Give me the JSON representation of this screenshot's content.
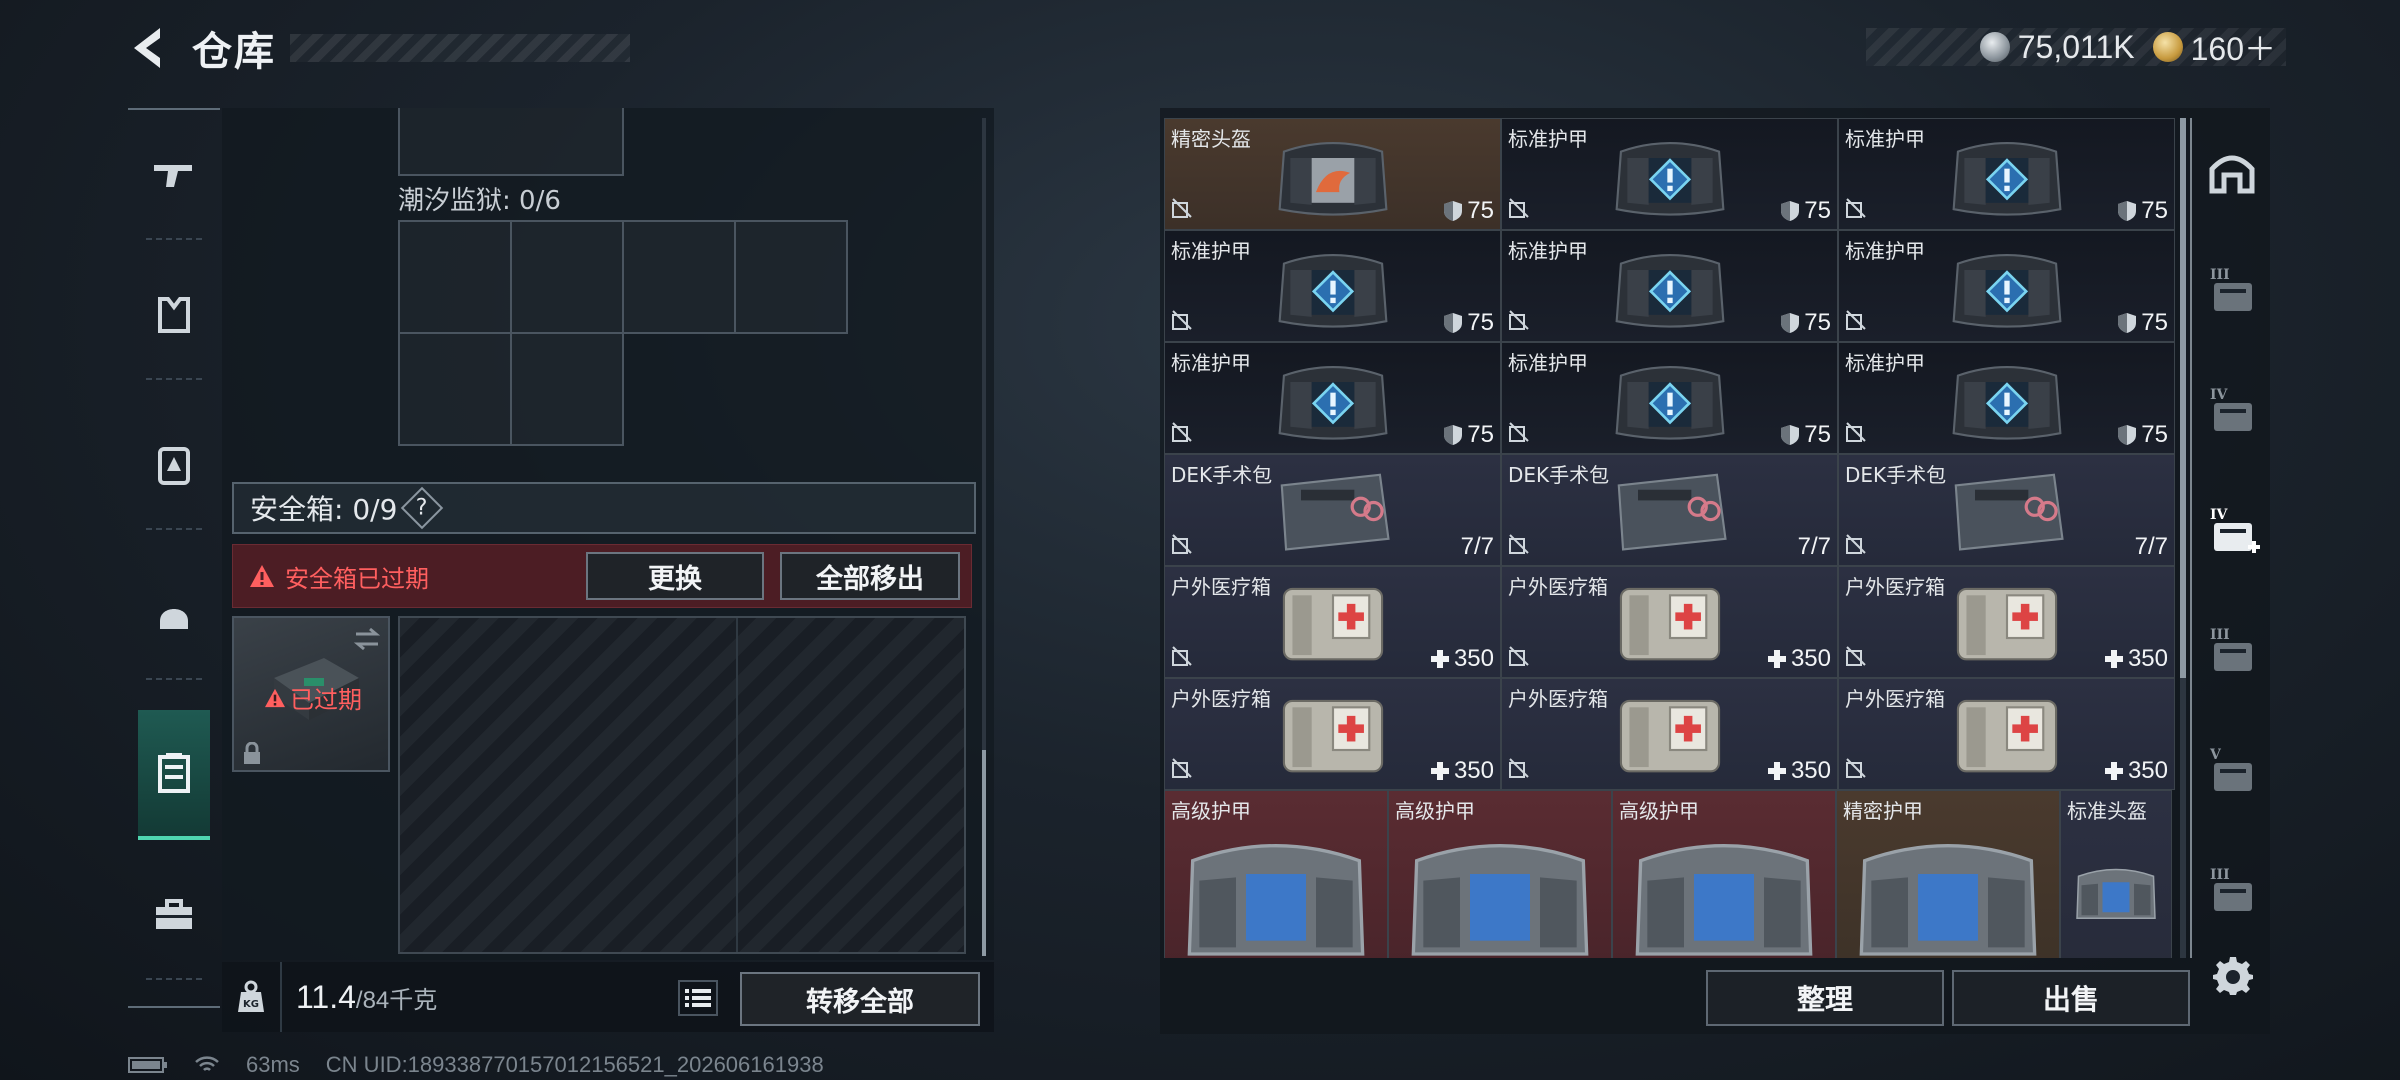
{
  "header": {
    "title": "仓库",
    "currency_silver": "75,011K",
    "currency_gold": "160＋"
  },
  "left_nav": [
    "gun",
    "vest",
    "backpack-armor",
    "helmet",
    "safebox",
    "toolbox"
  ],
  "left_panel": {
    "tide_prison_label": "潮汐监狱: 0/6",
    "safebox_label": "安全箱: 0/9",
    "safebox_help": "?",
    "expired_warning": "安全箱已过期",
    "replace_label": "更换",
    "remove_all_label": "全部移出",
    "thumb_expired": "已过期",
    "weight_value": "11.4",
    "weight_capacity": "/84千克",
    "transfer_all_label": "转移全部"
  },
  "status": {
    "ping": "63ms",
    "uid": "CN UID:1893387701570121565​21_202606161938"
  },
  "items": [
    {
      "name": "精密头盔",
      "stat": "75",
      "kind": "helmet-p"
    },
    {
      "name": "标准护甲",
      "stat": "75",
      "kind": "armor"
    },
    {
      "name": "标准护甲",
      "stat": "75",
      "kind": "armor"
    },
    {
      "name": "标准护甲",
      "stat": "75",
      "kind": "armor"
    },
    {
      "name": "标准护甲",
      "stat": "75",
      "kind": "armor"
    },
    {
      "name": "标准护甲",
      "stat": "75",
      "kind": "armor"
    },
    {
      "name": "标准护甲",
      "stat": "75",
      "kind": "armor"
    },
    {
      "name": "标准护甲",
      "stat": "75",
      "kind": "armor"
    },
    {
      "name": "标准护甲",
      "stat": "75",
      "kind": "armor"
    },
    {
      "name": "DEK手术包",
      "stat": "7/7",
      "kind": "surgery"
    },
    {
      "name": "DEK手术包",
      "stat": "7/7",
      "kind": "surgery"
    },
    {
      "name": "DEK手术包",
      "stat": "7/7",
      "kind": "surgery"
    },
    {
      "name": "户外医疗箱",
      "stat": "350",
      "kind": "medkit"
    },
    {
      "name": "户外医疗箱",
      "stat": "350",
      "kind": "medkit"
    },
    {
      "name": "户外医疗箱",
      "stat": "350",
      "kind": "medkit"
    },
    {
      "name": "户外医疗箱",
      "stat": "350",
      "kind": "medkit"
    },
    {
      "name": "户外医疗箱",
      "stat": "350",
      "kind": "medkit"
    },
    {
      "name": "户外医疗箱",
      "stat": "350",
      "kind": "medkit"
    }
  ],
  "bottom_row": [
    {
      "name": "高级护甲",
      "kind": "adv"
    },
    {
      "name": "高级护甲",
      "kind": "adv"
    },
    {
      "name": "高级护甲",
      "kind": "adv"
    },
    {
      "name": "精密护甲",
      "kind": "prec"
    },
    {
      "name": "标准头盔",
      "kind": "std-h"
    }
  ],
  "right_nav": [
    "helmet-slot",
    "III",
    "IV",
    "IV",
    "III",
    "V",
    "III"
  ],
  "right_nav_labels": [
    "",
    "III",
    "IV",
    "IV",
    "III",
    "V",
    "III"
  ],
  "actions": {
    "sort_label": "整理",
    "sell_label": "出售"
  },
  "colors": {
    "accent": "#4fd6b0",
    "expired": "#ff5f5f",
    "expired_bg": "#4c1d24"
  }
}
